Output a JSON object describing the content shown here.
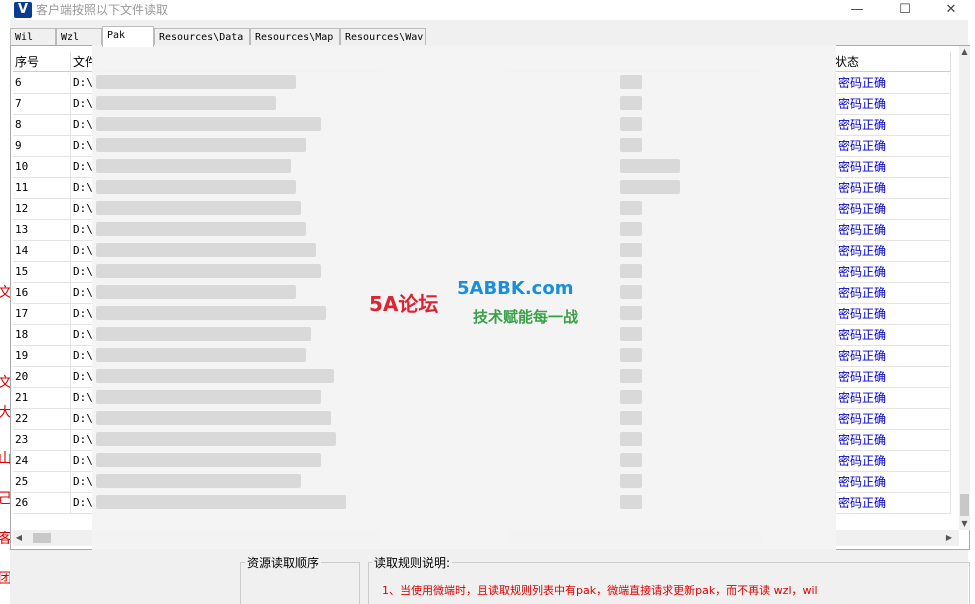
{
  "window": {
    "title": "客户端按照以下文件读取",
    "logo": "V",
    "min_glyph": "—",
    "max_glyph": "☐",
    "close_glyph": "✕"
  },
  "tabs": [
    {
      "label": "Wil"
    },
    {
      "label": "Wzl"
    },
    {
      "label": "Pak"
    },
    {
      "label": "Resources\\Data"
    },
    {
      "label": "Resources\\Map"
    },
    {
      "label": "Resources\\Wav"
    }
  ],
  "grid": {
    "columns": {
      "seq": "序号",
      "file": "文件",
      "status": "状态"
    },
    "rows": [
      {
        "seq": "6",
        "file": "D:\\",
        "status": "密码正确"
      },
      {
        "seq": "7",
        "file": "D:\\",
        "status": "密码正确"
      },
      {
        "seq": "8",
        "file": "D:\\",
        "status": "密码正确"
      },
      {
        "seq": "9",
        "file": "D:\\",
        "status": "密码正确"
      },
      {
        "seq": "10",
        "file": "D:\\",
        "status": "密码正确"
      },
      {
        "seq": "11",
        "file": "D:\\",
        "status": "密码正确"
      },
      {
        "seq": "12",
        "file": "D:\\",
        "status": "密码正确"
      },
      {
        "seq": "13",
        "file": "D:\\",
        "status": "密码正确"
      },
      {
        "seq": "14",
        "file": "D:\\",
        "status": "密码正确"
      },
      {
        "seq": "15",
        "file": "D:\\",
        "status": "密码正确"
      },
      {
        "seq": "16",
        "file": "D:\\",
        "status": "密码正确"
      },
      {
        "seq": "17",
        "file": "D:\\",
        "status": "密码正确"
      },
      {
        "seq": "18",
        "file": "D:\\",
        "status": "密码正确"
      },
      {
        "seq": "19",
        "file": "D:\\",
        "status": "密码正确"
      },
      {
        "seq": "20",
        "file": "D:\\",
        "status": "密码正确"
      },
      {
        "seq": "21",
        "file": "D:\\",
        "status": "密码正确"
      },
      {
        "seq": "22",
        "file": "D:\\",
        "status": "密码正确"
      },
      {
        "seq": "23",
        "file": "D:\\",
        "status": "密码正确"
      },
      {
        "seq": "24",
        "file": "D:\\",
        "status": "密码正确"
      },
      {
        "seq": "25",
        "file": "D:\\",
        "status": "密码正确"
      },
      {
        "seq": "26",
        "file": "D:\\",
        "status": "密码正确"
      }
    ]
  },
  "watermark": {
    "logo_text": "5A论坛",
    "site": "5ABBK.com",
    "slogan": "技术赋能每一战"
  },
  "bottom": {
    "order_label": "资源读取顺序",
    "rules_label": "读取规则说明:",
    "rule_1": "1、当使用微端时，且读取规则列表中有pak，微端直接请求更新pak，而不再读 wzl，wil"
  },
  "side_fragments": [
    "文",
    "文",
    "大",
    "山",
    "己",
    "客",
    "团"
  ],
  "colors": {
    "status_text": "#0000cc",
    "rule_text": "#dd0000"
  }
}
